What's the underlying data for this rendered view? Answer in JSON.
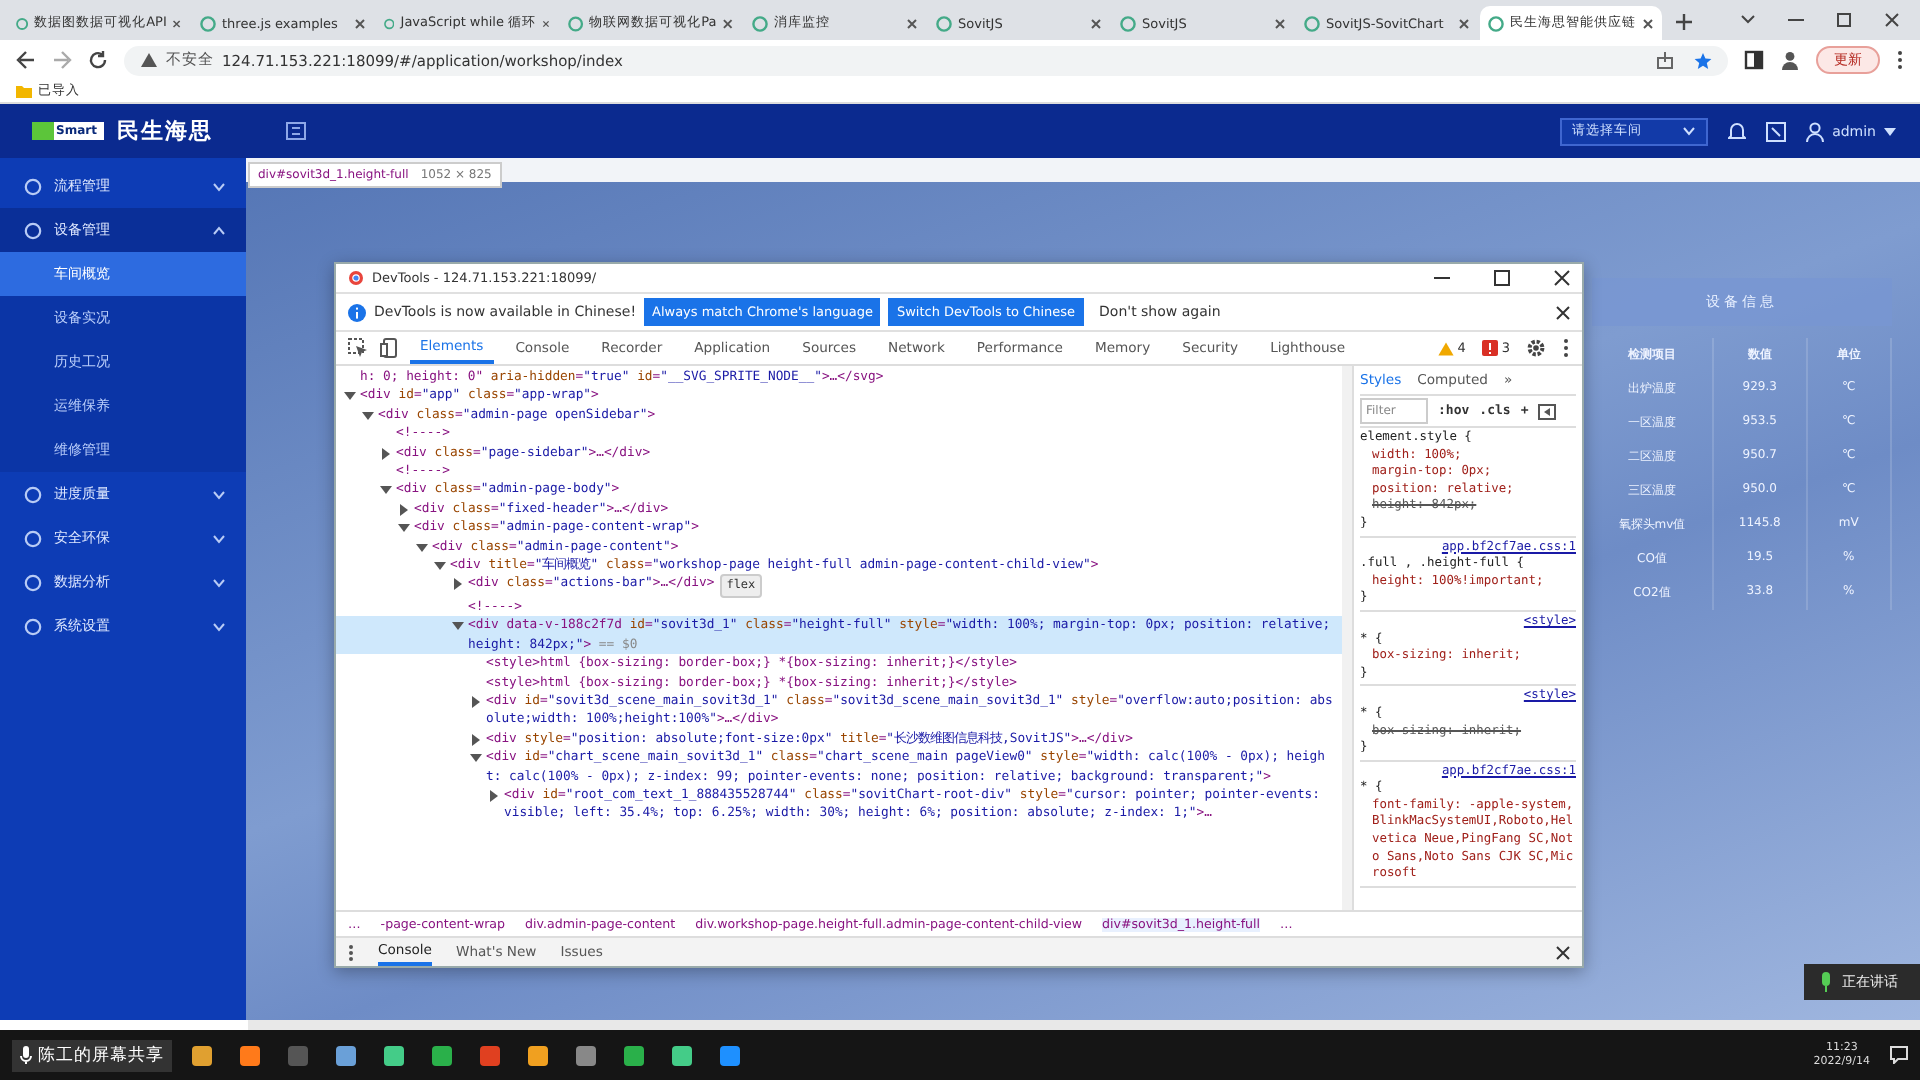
{
  "browser": {
    "tabs": [
      {
        "title": "数据图数据可视化API",
        "selected": false
      },
      {
        "title": "three.js examples",
        "selected": false
      },
      {
        "title": "JavaScript while 循环",
        "selected": false
      },
      {
        "title": "物联网数据可视化Pa",
        "selected": false
      },
      {
        "title": "消库监控",
        "selected": false
      },
      {
        "title": "SovitJS",
        "selected": false
      },
      {
        "title": "SovitJS",
        "selected": false
      },
      {
        "title": "SovitJS-SovitChart",
        "selected": false
      },
      {
        "title": "民生海思智能供应链",
        "selected": true
      }
    ],
    "security": "不安全",
    "url": "124.71.153.221:18099/#/application/workshop/index",
    "update_button": "更新",
    "bookmarks": [
      "已导入"
    ]
  },
  "app": {
    "logo_badge": "Smart",
    "brand": "民生海思",
    "sidebar": [
      {
        "label": "流程管理",
        "expanded": false
      },
      {
        "label": "设备管理",
        "expanded": true,
        "children": [
          {
            "label": "车间概览",
            "selected": true
          },
          {
            "label": "设备实况",
            "selected": false
          },
          {
            "label": "历史工况",
            "selected": false
          },
          {
            "label": "运维保养",
            "selected": false
          },
          {
            "label": "维修管理",
            "selected": false
          }
        ]
      },
      {
        "label": "进度质量",
        "expanded": false
      },
      {
        "label": "安全环保",
        "expanded": false
      },
      {
        "label": "数据分析",
        "expanded": false
      },
      {
        "label": "系统设置",
        "expanded": false
      }
    ],
    "workshop_select": "请选择车间",
    "user": "admin",
    "device_info": {
      "title": "设备信息",
      "columns": [
        "检测项目",
        "数值",
        "单位"
      ],
      "rows": [
        [
          "出炉温度",
          "929.3",
          "℃"
        ],
        [
          "一区温度",
          "953.5",
          "℃"
        ],
        [
          "二区温度",
          "950.7",
          "℃"
        ],
        [
          "三区温度",
          "950.0",
          "℃"
        ],
        [
          "氧探头mv值",
          "1145.8",
          "mV"
        ],
        [
          "CO值",
          "19.5",
          "%"
        ],
        [
          "CO2值",
          "33.8",
          "%"
        ]
      ]
    }
  },
  "inspect_tooltip": {
    "selector": "div#sovit3d_1.height-full",
    "size": "1052 × 825"
  },
  "devtools": {
    "title": "DevTools - 124.71.153.221:18099/",
    "info": {
      "message": "DevTools is now available in Chinese!",
      "buttons": [
        "Always match Chrome's language",
        "Switch DevTools to Chinese"
      ],
      "dismiss": "Don't show again"
    },
    "tabs": [
      {
        "label": "Elements",
        "selected": true
      },
      {
        "label": "Console",
        "selected": false
      },
      {
        "label": "Recorder",
        "selected": false
      },
      {
        "label": "Application",
        "selected": false
      },
      {
        "label": "Sources",
        "selected": false
      },
      {
        "label": "Network",
        "selected": false
      },
      {
        "label": "Performance",
        "selected": false
      },
      {
        "label": "Memory",
        "selected": false
      },
      {
        "label": "Security",
        "selected": false
      },
      {
        "label": "Lighthouse",
        "selected": false
      }
    ],
    "warnings": "4",
    "errors": "3",
    "tree": [
      {
        "text": "h: 0; height: 0\" aria-hidden=\"true\" id=\"__SVG_SPRITE_NODE__\">…</svg>",
        "selected": false
      },
      {
        "text": "<div id=\"app\" class=\"app-wrap\">",
        "expanded": true,
        "selected": false,
        "children": [
          {
            "text": "<div class=\"admin-page openSidebar\">",
            "expanded": true,
            "selected": false,
            "children": [
              {
                "text": "<!---->",
                "selected": false
              },
              {
                "text": "<div class=\"page-sidebar\">…</div>",
                "expanded": false,
                "selected": false
              },
              {
                "text": "<!---->",
                "selected": false
              },
              {
                "text": "<div class=\"admin-page-body\">",
                "expanded": true,
                "selected": false,
                "children": [
                  {
                    "text": "<div class=\"fixed-header\">…</div>",
                    "expanded": false,
                    "selected": false
                  },
                  {
                    "text": "<div class=\"admin-page-content-wrap\">",
                    "expanded": true,
                    "selected": false,
                    "children": [
                      {
                        "text": "<div class=\"admin-page-content\">",
                        "expanded": true,
                        "selected": false,
                        "children": [
                          {
                            "text": "<div title=\"车间概览\" class=\"workshop-page height-full admin-page-content-child-view\">",
                            "expanded": true,
                            "selected": false,
                            "children": [
                              {
                                "text": "<div class=\"actions-bar\">…</div>",
                                "expanded": false,
                                "selected": false,
                                "badge": "flex"
                              },
                              {
                                "text": "<!---->",
                                "selected": false
                              },
                              {
                                "text": "<div data-v-188c2f7d id=\"sovit3d_1\" class=\"height-full\" style=\"width: 100%; margin-top: 0px; position: relative; height: 842px;\">",
                                "suffix": "== $0",
                                "expanded": true,
                                "selected": true,
                                "children": [
                                  {
                                    "text": "<style>html {box-sizing: border-box;} *{box-sizing: inherit;}</style>",
                                    "selected": false
                                  },
                                  {
                                    "text": "<style>html {box-sizing: border-box;} *{box-sizing: inherit;}</style>",
                                    "selected": false
                                  },
                                  {
                                    "text": "<div id=\"sovit3d_scene_main_sovit3d_1\" class=\"sovit3d_scene_main_sovit3d_1\" style=\"overflow:auto;position: absolute;width: 100%;height:100%\">…</div>",
                                    "expanded": false,
                                    "selected": false
                                  },
                                  {
                                    "text": "<div style=\"position: absolute;font-size:0px\" title=\"长沙数维图信息科技,SovitJS\">…</div>",
                                    "expanded": false,
                                    "selected": false
                                  },
                                  {
                                    "text": "<div id=\"chart_scene_main_sovit3d_1\" class=\"chart_scene_main pageView0\" style=\"width: calc(100% - 0px); height: calc(100% - 0px); z-index: 99; pointer-events: none; position: relative; background: transparent;\">",
                                    "expanded": true,
                                    "selected": false,
                                    "children": [
                                      {
                                        "text": "<div id=\"root_com_text_1_888435528744\" class=\"sovitChart-root-div\" style=\"cursor: pointer; pointer-events: visible; left: 35.4%; top: 6.25%; width: 30%; height: 6%; position: absolute; z-index: 1;\">…",
                                        "expanded": false,
                                        "selected": false
                                      }
                                    ]
                                  }
                                ]
                              }
                            ]
                          }
                        ]
                      }
                    ]
                  }
                ]
              }
            ]
          }
        ]
      }
    ],
    "breadcrumbs": [
      "…",
      "-page-content-wrap",
      "div.admin-page-content",
      "div.workshop-page.height-full.admin-page-content-child-view",
      "div#sovit3d_1.height-full",
      "…"
    ],
    "styles_tabs": [
      {
        "label": "Styles",
        "selected": true
      },
      {
        "label": "Computed",
        "selected": false
      },
      {
        "label": "»",
        "selected": false
      }
    ],
    "filter_placeholder": "Filter",
    "hov": ":hov",
    "cls": ".cls",
    "add": "+",
    "rules": [
      {
        "selector": "element.style {",
        "props": [
          {
            "text": "width: 100%;",
            "struck": false
          },
          {
            "text": "margin-top: 0px;",
            "struck": false
          },
          {
            "text": "position: relative;",
            "struck": false
          },
          {
            "text": "height: 842px;",
            "struck": true
          }
        ],
        "close": "}"
      },
      {
        "source": "app.bf2cf7ae.css:1",
        "selector": ".full , .height-full {",
        "props": [
          {
            "text": "height: 100%!important;",
            "struck": false
          }
        ],
        "close": "}"
      },
      {
        "source": "<style>",
        "selector": "* {",
        "props": [
          {
            "text": "box-sizing: inherit;",
            "struck": false
          }
        ],
        "close": "}"
      },
      {
        "source": "<style>",
        "selector": "* {",
        "props": [
          {
            "text": "box-sizing: inherit;",
            "struck": true
          }
        ],
        "close": "}"
      },
      {
        "source": "app.bf2cf7ae.css:1",
        "selector": "* {",
        "props": [
          {
            "text": "font-family: -apple-system,BlinkMacSystemUI,Roboto,Helvetica Neue,PingFang SC,Noto Sans,Noto Sans CJK SC,Microsoft",
            "struck": false
          }
        ]
      }
    ],
    "drawer_tabs": [
      {
        "label": "Console",
        "selected": true
      },
      {
        "label": "What's New",
        "selected": false
      },
      {
        "label": "Issues",
        "selected": false
      }
    ]
  },
  "screen_share": "陈工的屏幕共享",
  "speaking": "正在讲话",
  "taskbar": {
    "time": "11:23",
    "date": "2022/9/14"
  }
}
